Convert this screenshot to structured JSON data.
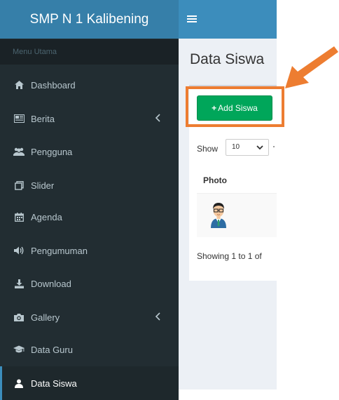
{
  "sidebar": {
    "brand": "SMP N 1 Kalibening",
    "menu_header": "Menu Utama",
    "items": [
      {
        "label": "Dashboard",
        "icon": "home-icon",
        "has_submenu": false
      },
      {
        "label": "Berita",
        "icon": "newspaper-icon",
        "has_submenu": true
      },
      {
        "label": "Pengguna",
        "icon": "users-icon",
        "has_submenu": false
      },
      {
        "label": "Slider",
        "icon": "clone-icon",
        "has_submenu": false
      },
      {
        "label": "Agenda",
        "icon": "calendar-icon",
        "has_submenu": false
      },
      {
        "label": "Pengumuman",
        "icon": "volume-icon",
        "has_submenu": false
      },
      {
        "label": "Download",
        "icon": "download-icon",
        "has_submenu": false
      },
      {
        "label": "Gallery",
        "icon": "camera-icon",
        "has_submenu": true
      },
      {
        "label": "Data Guru",
        "icon": "graduation-cap-icon",
        "has_submenu": false
      },
      {
        "label": "Data Siswa",
        "icon": "user-icon",
        "has_submenu": false,
        "active": true
      }
    ]
  },
  "topbar": {
    "menu_icon": "hamburger-icon"
  },
  "main": {
    "page_title": "Data Siswa",
    "add_button_label": "Add Siswa",
    "show_label": "Show",
    "entries_selected": "10",
    "table": {
      "headers": [
        "Photo"
      ]
    },
    "showing_text": "Showing 1 to 1 of"
  },
  "annotation": {
    "highlight_color": "#ed7d31",
    "arrow_color": "#ed7d31"
  },
  "colors": {
    "sidebar_bg": "#222d32",
    "brand_bg": "#367fa9",
    "topbar_bg": "#3c8dbc",
    "add_button_bg": "#00a65a"
  }
}
